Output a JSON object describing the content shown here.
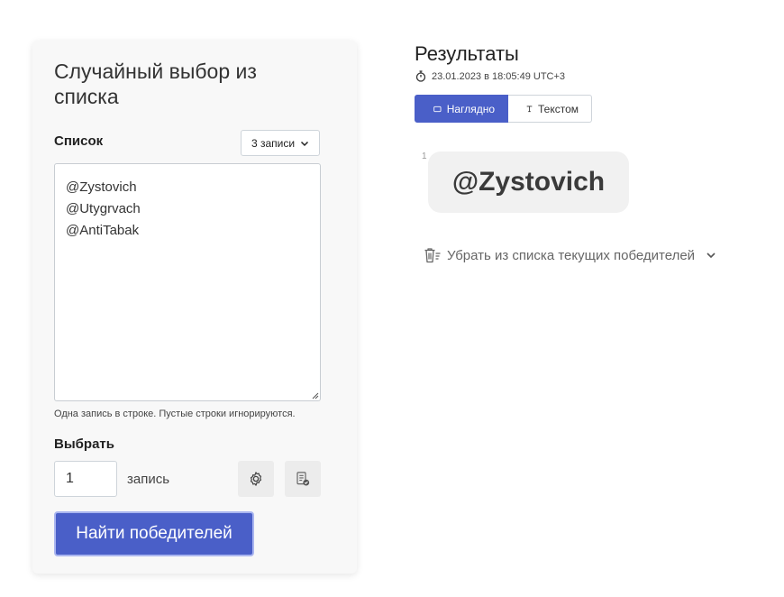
{
  "form": {
    "title": "Случайный выбор из списка",
    "list_label": "Список",
    "count_select": "3 записи",
    "entries": [
      "@Zystovich",
      "@Utygrvach",
      "@AntiTabak"
    ],
    "hint": "Одна запись в строке. Пустые строки игнорируются.",
    "pick_label": "Выбрать",
    "quantity": "1",
    "unit": "запись",
    "submit_label": "Найти победителей"
  },
  "results": {
    "title": "Результаты",
    "timestamp": "23.01.2023 в 18:05:49 UTC+3",
    "tabs": [
      {
        "label": "Наглядно",
        "icon": "rectangle-icon",
        "active": true
      },
      {
        "label": "Текстом",
        "icon": "text-t-icon",
        "active": false
      }
    ],
    "winners": [
      {
        "index": "1",
        "name": "@Zystovich"
      }
    ],
    "remove_label": "Убрать из списка текущих победителей"
  },
  "colors": {
    "primary": "#4a5fc8",
    "card_bg": "#f8f8f8",
    "chip_bg": "#f1f1f1"
  }
}
